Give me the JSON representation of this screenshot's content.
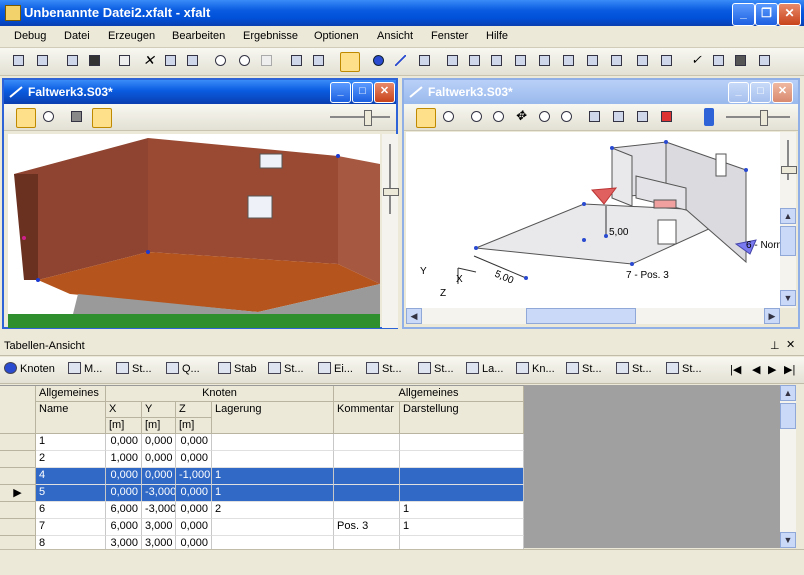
{
  "window": {
    "title": "Unbenannte Datei2.xfalt - xfalt"
  },
  "menu": [
    "Debug",
    "Datei",
    "Erzeugen",
    "Bearbeiten",
    "Ergebnisse",
    "Optionen",
    "Ansicht",
    "Fenster",
    "Hilfe"
  ],
  "left_view": {
    "title": "Faltwerk3.S03*"
  },
  "right_view": {
    "title": "Faltwerk3.S03*",
    "labels": {
      "dim1": "5,00",
      "dim2": "5,00",
      "pos": "7 - Pos. 3",
      "norm": "6 - Norm",
      "axis_y": "Y",
      "axis_x": "X",
      "axis_z": "Z"
    }
  },
  "table_panel": {
    "title": "Tabellen-Ansicht",
    "pin": "\u0004 ×",
    "tabs": [
      "Knoten",
      "M...",
      "St...",
      "Q...",
      "Stab",
      "St...",
      "Ei...",
      "St...",
      "St...",
      "La...",
      "Kn...",
      "St...",
      "St...",
      "St..."
    ],
    "group_headers": {
      "allgemeines1": "Allgemeines",
      "knoten": "Knoten",
      "allgemeines2": "Allgemeines"
    },
    "columns": {
      "name": "Name",
      "x": "X",
      "y": "Y",
      "z": "Z",
      "lagerung": "Lagerung",
      "kommentar": "Kommentar",
      "darstellung": "Darstellung"
    },
    "units": {
      "x": "[m]",
      "y": "[m]",
      "z": "[m]"
    },
    "rows": [
      {
        "name": "1",
        "x": "0,000",
        "y": "0,000",
        "z": "0,000",
        "lagerung": "",
        "kommentar": "",
        "darstellung": ""
      },
      {
        "name": "2",
        "x": "1,000",
        "y": "0,000",
        "z": "0,000",
        "lagerung": "",
        "kommentar": "",
        "darstellung": ""
      },
      {
        "name": "4",
        "x": "0,000",
        "y": "0,000",
        "z": "-1,000",
        "lagerung": "1",
        "kommentar": "",
        "darstellung": ""
      },
      {
        "name": "5",
        "x": "0,000",
        "y": "-3,000",
        "z": "0,000",
        "lagerung": "1",
        "kommentar": "",
        "darstellung": ""
      },
      {
        "name": "6",
        "x": "6,000",
        "y": "-3,000",
        "z": "0,000",
        "lagerung": "2",
        "kommentar": "",
        "darstellung": "1"
      },
      {
        "name": "7",
        "x": "6,000",
        "y": "3,000",
        "z": "0,000",
        "lagerung": "",
        "kommentar": "Pos. 3",
        "darstellung": "1"
      },
      {
        "name": "8",
        "x": "3,000",
        "y": "3,000",
        "z": "0,000",
        "lagerung": "",
        "kommentar": "",
        "darstellung": ""
      }
    ]
  },
  "colors": {
    "title_blue": "#0A5BE0",
    "selection": "#3169C6",
    "brick": "#9A4A32",
    "floor": "#B5541C",
    "ground": "#9A9A9A"
  }
}
